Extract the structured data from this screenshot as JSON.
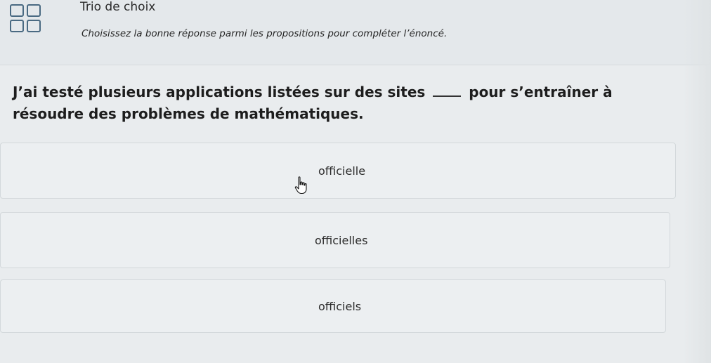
{
  "header": {
    "title": "Trio de choix",
    "instruction": "Choisissez la bonne réponse parmi les propositions pour compléter l’énoncé.",
    "icon": "grid-icon"
  },
  "question": {
    "before_blank": "J’ai testé plusieurs applications listées sur des sites",
    "after_blank": "pour s’entraîner à résoudre des problèmes de mathématiques."
  },
  "options": [
    {
      "label": "officielle"
    },
    {
      "label": "officielles"
    },
    {
      "label": "officiels"
    }
  ],
  "colors": {
    "accent": "#4a6a82",
    "background": "#e9ecee"
  },
  "cursor": {
    "icon": "hand-pointer-icon"
  }
}
